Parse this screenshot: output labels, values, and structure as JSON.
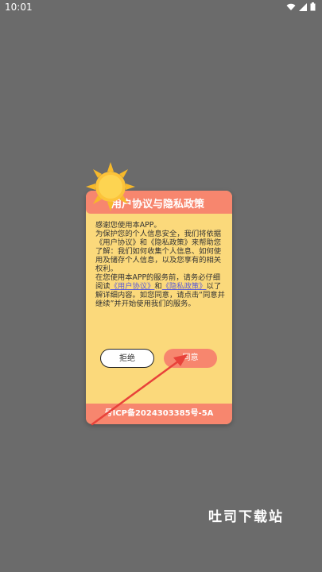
{
  "status_bar": {
    "time": "10:01"
  },
  "dialog": {
    "title": "用户协议与隐私政策",
    "body": {
      "greeting": "感谢您使用本APP。",
      "p1_a": "为保护您的个人信息安全，我们将依据",
      "p1_link1": "《用户协议》",
      "p1_b": "和",
      "p1_link2": "《隐私政策》",
      "p1_c": "来帮助您了解：我们如何收集个人信息、如何使用及储存个人信息，以及您享有的相关权利。",
      "p2_a": "在您使用本APP的服务前，请务必仔细阅读",
      "p2_link1": "《用户协议》",
      "p2_b": "和",
      "p2_link2": "《隐私政策》",
      "p2_c": "以了解详细内容。如您同意，请点击“同意并继续”并开始使用我们的服务。"
    },
    "reject_label": "拒绝",
    "agree_label": "同意",
    "footer": "号ICP备2024303385号-5A"
  },
  "watermark": "吐司下载站",
  "colors": {
    "overlay": "#6b6b6b",
    "dialog_bg": "#fbd97b",
    "accent": "#f7866e",
    "arrow": "#e8423a",
    "link": "#5b5bd6"
  },
  "icons": {
    "sun": "sun-icon",
    "arrow": "arrow-annotation",
    "wifi": "wifi-icon",
    "signal": "signal-icon",
    "battery": "battery-icon"
  }
}
